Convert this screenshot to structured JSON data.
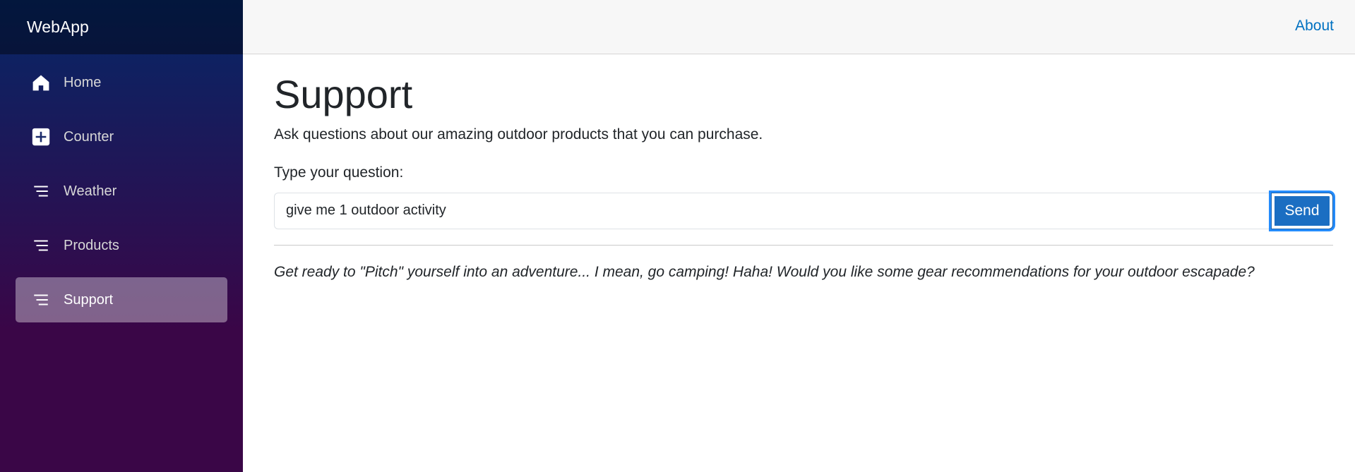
{
  "sidebar": {
    "brand": "WebApp",
    "items": [
      {
        "label": "Home",
        "icon": "home-icon",
        "active": false
      },
      {
        "label": "Counter",
        "icon": "plus-square-icon",
        "active": false
      },
      {
        "label": "Weather",
        "icon": "list-icon",
        "active": false
      },
      {
        "label": "Products",
        "icon": "list-icon",
        "active": false
      },
      {
        "label": "Support",
        "icon": "list-icon",
        "active": true
      }
    ]
  },
  "header": {
    "about_label": "About"
  },
  "main": {
    "title": "Support",
    "intro": "Ask questions about our amazing outdoor products that you can purchase.",
    "question_label": "Type your question:",
    "question_value": "give me 1 outdoor activity",
    "send_label": "Send",
    "answer": "Get ready to \"Pitch\" yourself into an adventure... I mean, go camping! Haha! Would you like some gear recommendations for your outdoor escapade?"
  },
  "colors": {
    "sidebar_top": "#052767",
    "sidebar_bottom": "#3a0647",
    "accent": "#1b6ec2",
    "link": "#0071c1"
  }
}
